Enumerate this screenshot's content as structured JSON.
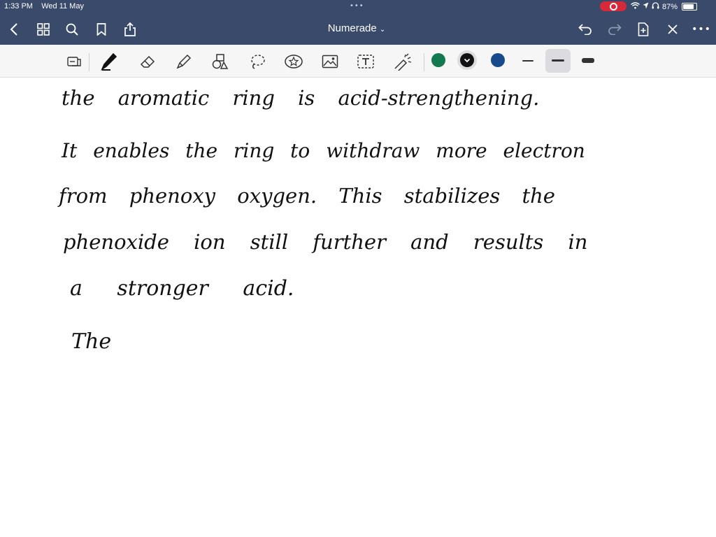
{
  "status_bar": {
    "time": "1:33 PM",
    "date": "Wed 11 May",
    "battery_percent": "87%"
  },
  "nav": {
    "doc_title": "Numerade",
    "dropdown_icon": "chevron-down-icon"
  },
  "toolbar": {
    "colors": [
      "#137a4f",
      "#111111",
      "#174a8c"
    ],
    "selected_color_index": 1,
    "selected_stroke_index": 1
  },
  "note_lines": [
    "the aromatic ring is acid-strengthening.",
    "It enables the ring to withdraw more electron",
    "from phenoxy oxygen. This stabilizes the",
    "phenoxide ion still further and results in",
    "a stronger acid.",
    "The"
  ]
}
